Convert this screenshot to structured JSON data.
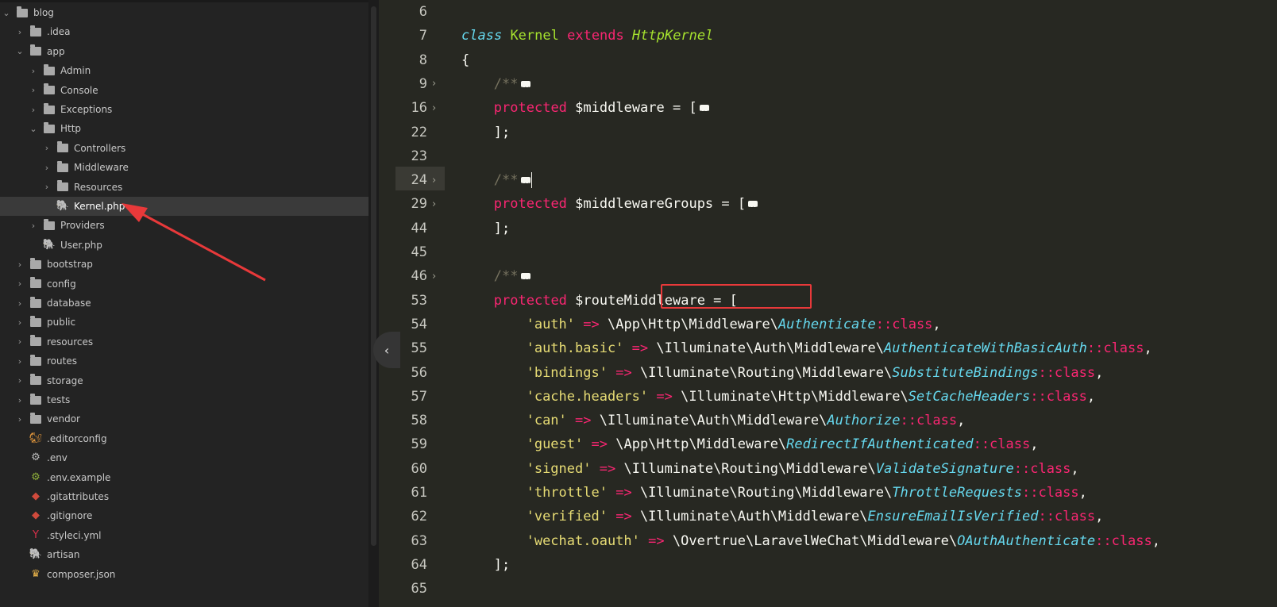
{
  "tree": [
    {
      "label": "blog",
      "depth": 0,
      "type": "folder",
      "expanded": true
    },
    {
      "label": ".idea",
      "depth": 1,
      "type": "folder",
      "expanded": false
    },
    {
      "label": "app",
      "depth": 1,
      "type": "folder",
      "expanded": true
    },
    {
      "label": "Admin",
      "depth": 2,
      "type": "folder",
      "expanded": false
    },
    {
      "label": "Console",
      "depth": 2,
      "type": "folder",
      "expanded": false
    },
    {
      "label": "Exceptions",
      "depth": 2,
      "type": "folder",
      "expanded": false
    },
    {
      "label": "Http",
      "depth": 2,
      "type": "folder",
      "expanded": true
    },
    {
      "label": "Controllers",
      "depth": 3,
      "type": "folder",
      "expanded": false
    },
    {
      "label": "Middleware",
      "depth": 3,
      "type": "folder",
      "expanded": false
    },
    {
      "label": "Resources",
      "depth": 3,
      "type": "folder",
      "expanded": false
    },
    {
      "label": "Kernel.php",
      "depth": 3,
      "type": "php",
      "selected": true
    },
    {
      "label": "Providers",
      "depth": 2,
      "type": "folder",
      "expanded": false
    },
    {
      "label": "User.php",
      "depth": 2,
      "type": "php"
    },
    {
      "label": "bootstrap",
      "depth": 1,
      "type": "folder",
      "expanded": false
    },
    {
      "label": "config",
      "depth": 1,
      "type": "folder",
      "expanded": false
    },
    {
      "label": "database",
      "depth": 1,
      "type": "folder",
      "expanded": false
    },
    {
      "label": "public",
      "depth": 1,
      "type": "folder",
      "expanded": false
    },
    {
      "label": "resources",
      "depth": 1,
      "type": "folder",
      "expanded": false
    },
    {
      "label": "routes",
      "depth": 1,
      "type": "folder",
      "expanded": false
    },
    {
      "label": "storage",
      "depth": 1,
      "type": "folder",
      "expanded": false
    },
    {
      "label": "tests",
      "depth": 1,
      "type": "folder",
      "expanded": false
    },
    {
      "label": "vendor",
      "depth": 1,
      "type": "folder",
      "expanded": false
    },
    {
      "label": ".editorconfig",
      "depth": 1,
      "type": "editorconfig"
    },
    {
      "label": ".env",
      "depth": 1,
      "type": "gear"
    },
    {
      "label": ".env.example",
      "depth": 1,
      "type": "gear-green"
    },
    {
      "label": ".gitattributes",
      "depth": 1,
      "type": "git"
    },
    {
      "label": ".gitignore",
      "depth": 1,
      "type": "git"
    },
    {
      "label": ".styleci.yml",
      "depth": 1,
      "type": "styleci"
    },
    {
      "label": "artisan",
      "depth": 1,
      "type": "php"
    },
    {
      "label": "composer.json",
      "depth": 1,
      "type": "composer"
    }
  ],
  "gutter": [
    {
      "num": "6",
      "fold": false
    },
    {
      "num": "7",
      "fold": false
    },
    {
      "num": "8",
      "fold": false
    },
    {
      "num": "9",
      "fold": true
    },
    {
      "num": "16",
      "fold": true
    },
    {
      "num": "22",
      "fold": false
    },
    {
      "num": "23",
      "fold": false
    },
    {
      "num": "24",
      "fold": true
    },
    {
      "num": "29",
      "fold": true
    },
    {
      "num": "44",
      "fold": false
    },
    {
      "num": "45",
      "fold": false
    },
    {
      "num": "46",
      "fold": true
    },
    {
      "num": "53",
      "fold": false
    },
    {
      "num": "54",
      "fold": false
    },
    {
      "num": "55",
      "fold": false
    },
    {
      "num": "56",
      "fold": false
    },
    {
      "num": "57",
      "fold": false
    },
    {
      "num": "58",
      "fold": false
    },
    {
      "num": "59",
      "fold": false
    },
    {
      "num": "60",
      "fold": false
    },
    {
      "num": "61",
      "fold": false
    },
    {
      "num": "62",
      "fold": false
    },
    {
      "num": "63",
      "fold": false
    },
    {
      "num": "64",
      "fold": false
    },
    {
      "num": "65",
      "fold": false
    }
  ],
  "code": {
    "class_kw": "class",
    "class_name": "Kernel",
    "extends_kw": "extends",
    "parent_class": "HttpKernel",
    "open_brace": "{",
    "docblock": "/**",
    "protected_kw": "protected",
    "middleware_var": "$middleware",
    "middleware_groups_var": "$middlewareGroups",
    "route_middleware_var": "$routeMiddleware",
    "assign_open": " = [",
    "assign_op": "=",
    "open_bracket": "[",
    "close_bracket": "];",
    "route_entries": [
      {
        "key": "'auth'",
        "ns": "\\App\\Http\\Middleware\\",
        "cls": "Authenticate"
      },
      {
        "key": "'auth.basic'",
        "ns": "\\Illuminate\\Auth\\Middleware\\",
        "cls": "AuthenticateWithBasicAuth"
      },
      {
        "key": "'bindings'",
        "ns": "\\Illuminate\\Routing\\Middleware\\",
        "cls": "SubstituteBindings"
      },
      {
        "key": "'cache.headers'",
        "ns": "\\Illuminate\\Http\\Middleware\\",
        "cls": "SetCacheHeaders"
      },
      {
        "key": "'can'",
        "ns": "\\Illuminate\\Auth\\Middleware\\",
        "cls": "Authorize"
      },
      {
        "key": "'guest'",
        "ns": "\\App\\Http\\Middleware\\",
        "cls": "RedirectIfAuthenticated"
      },
      {
        "key": "'signed'",
        "ns": "\\Illuminate\\Routing\\Middleware\\",
        "cls": "ValidateSignature"
      },
      {
        "key": "'throttle'",
        "ns": "\\Illuminate\\Routing\\Middleware\\",
        "cls": "ThrottleRequests"
      },
      {
        "key": "'verified'",
        "ns": "\\Illuminate\\Auth\\Middleware\\",
        "cls": "EnsureEmailIsVerified"
      },
      {
        "key": "'wechat.oauth'",
        "ns": "\\Overtrue\\LaravelWeChat\\Middleware\\",
        "cls": "OAuthAuthenticate"
      }
    ],
    "arrow_op": "=>",
    "class_suffix": "::class",
    "comma": ","
  },
  "colors": {
    "editor_bg": "#272822",
    "sidebar_bg": "#232323",
    "keyword": "#f92672",
    "class_name": "#a6e22e",
    "string": "#e6db74",
    "comment": "#75715e",
    "italic_type": "#66d9ef",
    "annotation_red": "#e8393a"
  },
  "collapse_button": {
    "icon": "chevron-left-icon",
    "glyph": "‹"
  }
}
